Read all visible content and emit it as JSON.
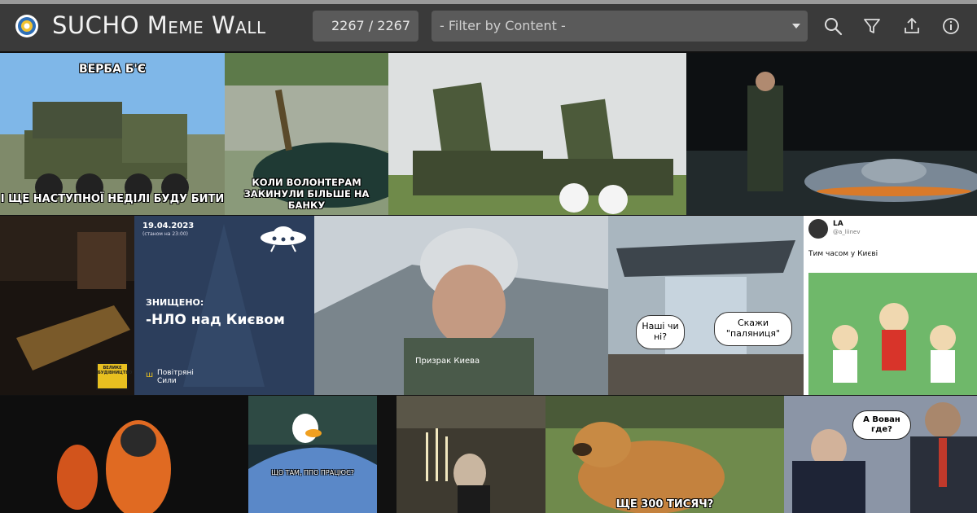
{
  "header": {
    "app_title": "SUCHO Meme Wall",
    "counter": "2267 / 2267",
    "filter_placeholder": "- Filter by Content -",
    "tools": [
      "search-icon",
      "filter-icon",
      "upload-icon",
      "info-icon"
    ]
  },
  "memes": {
    "verba_top": "ВЕРБА Б'Є",
    "verba_bottom": "І ЩЕ НАСТУПНОЇ НЕДІЛІ БУДУ БИТИ",
    "volunteers": "КОЛИ ВОЛОНТЕРАМ ЗАКИНУЛИ БІЛЬШЕ НА БАНКУ",
    "dark_badge": "ВЕЛИКЕ БУДІВНИЦТВО",
    "ufo_date": "19.04.2023",
    "ufo_time": "(станом на 23:00)",
    "ufo_destroyed": "ЗНИЩЕНО:",
    "ufo_item": "-НЛО над Києвом",
    "ufo_footer": "Повітряні Сили",
    "pilot_caption": "Призрак Киева",
    "ship_bubble_left": "Наші чи ні?",
    "ship_bubble_right": "Скажи \"паляниця\"",
    "tweet_name": "LA",
    "tweet_handle": "@a_liinev",
    "tweet_text": "Тим часом у Києві",
    "duck_caption": "ЩО ТАМ, ППО ПРАЦЮЄ?",
    "dog_caption": "ЩЕ 300 ТИСЯЧ?",
    "vovan_bubble": "А Вован где?"
  },
  "colors": {
    "header_bg": "#3a3a3a",
    "field_bg": "#5a5a5a",
    "ufo_panel_bg": "#2c3e5c"
  }
}
